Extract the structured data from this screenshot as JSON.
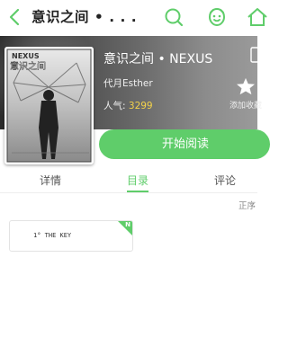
{
  "header": {
    "title": "意识之间 • . . .",
    "icons": [
      "back-arrow-icon",
      "search-icon",
      "face-icon",
      "home-icon"
    ]
  },
  "book": {
    "title": "意识之间 • NEXUS",
    "author": "代月Esther",
    "popularity_label": "人气:",
    "popularity_value": "3299",
    "cover_text": "NEXUS",
    "cover_subtitle": "意识之间",
    "favorite_label": "添加收藏"
  },
  "actions": {
    "read_button": "开始阅读"
  },
  "tabs": [
    {
      "label": "详情"
    },
    {
      "label": "目录"
    },
    {
      "label": "评论"
    }
  ],
  "catalog": {
    "sort_label": "正序",
    "chapters": [
      {
        "label": "1° THE KEY",
        "badge": "N"
      }
    ]
  },
  "colors": {
    "accent": "#5fcd6a",
    "popularity": "#f3d24a"
  }
}
